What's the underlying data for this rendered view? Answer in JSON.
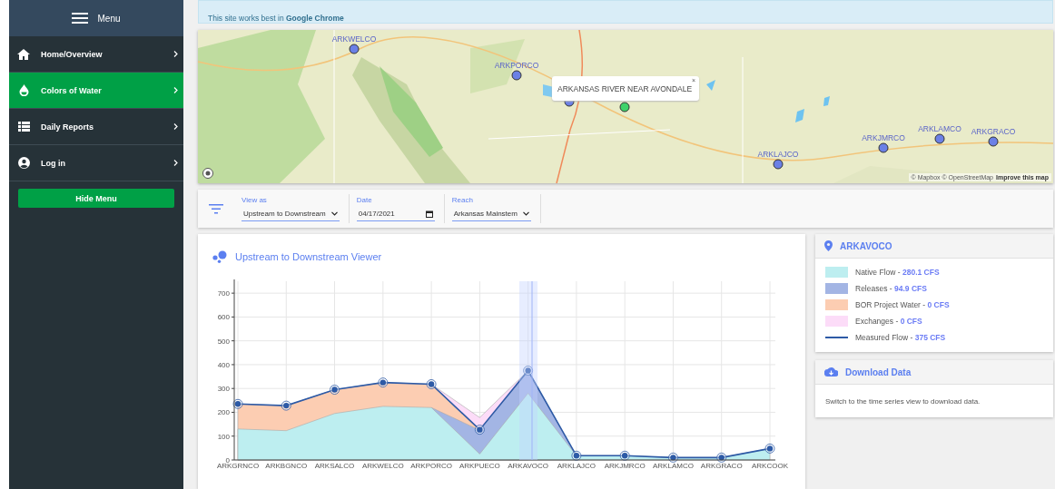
{
  "sidebar": {
    "title": "Menu",
    "items": [
      {
        "label": "Home/Overview",
        "selected": false
      },
      {
        "label": "Colors of Water",
        "selected": true
      },
      {
        "label": "Daily Reports",
        "selected": false
      },
      {
        "label": "Log in",
        "selected": false
      }
    ],
    "hide_button": "Hide Menu"
  },
  "notice": "This site works best in **Google Chrome**",
  "map": {
    "markers": [
      {
        "label": "ARKWELCO",
        "selected": false
      },
      {
        "label": "ARKPORCO",
        "selected": false
      },
      {
        "selected": false
      },
      {
        "selected": true
      },
      {
        "label": "ARKLAJCO",
        "selected": false
      },
      {
        "label": "ARKJMRCO",
        "selected": false
      },
      {
        "label": "ARKLAMCO",
        "selected": false
      },
      {
        "label": "ARKGRACO",
        "selected": false
      }
    ],
    "popup": "ARKANSAS RIVER NEAR AVONDALE",
    "popup_close": "×",
    "attribution": "© Mapbox © OpenStreetMap",
    "improve_link": "Improve this map"
  },
  "filters": [
    {
      "label": "View as",
      "value": "Upstream to Downstream",
      "kind": "select"
    },
    {
      "label": "Date",
      "value": "04/17/2021",
      "kind": "date"
    },
    {
      "label": "Reach",
      "value": "Arkansas Mainstem",
      "kind": "select"
    }
  ],
  "viewer": {
    "title": "Upstream to Downstream Viewer",
    "chart_data": {
      "type": "area",
      "grid": true,
      "categories": [
        "ARKGRNCO",
        "ARKBGNCO",
        "ARKSALCO",
        "ARKWELCO",
        "ARKPORCO",
        "ARKPUECO",
        "ARKAVOCO",
        "ARKLAJCO",
        "ARKJMRCO",
        "ARKLAMCO",
        "ARKGRACO",
        "ARKCOOK"
      ],
      "series": [
        {
          "name": "Native Flow",
          "color": "#bdeef0",
          "values": [
            130,
            123,
            195,
            225,
            220,
            25,
            280,
            18,
            18,
            10,
            10,
            48
          ]
        },
        {
          "name": "Releases",
          "color": "#a3b5e4",
          "values": [
            null,
            null,
            null,
            null,
            220,
            125,
            375,
            18,
            null,
            null,
            null,
            null
          ]
        },
        {
          "name": "BOR Project Water",
          "color": "#fccdb2",
          "values": [
            235,
            228,
            295,
            325,
            318,
            125,
            null,
            null,
            null,
            null,
            null,
            null
          ]
        },
        {
          "name": "Exchanges",
          "color": "#fcdcf8",
          "values": [
            null,
            null,
            null,
            null,
            318,
            178,
            375,
            null,
            null,
            null,
            null,
            null
          ]
        },
        {
          "name": "Measured Flow",
          "type": "line",
          "marker": "circle",
          "color": "#2d5aa6",
          "values": [
            235,
            228,
            295,
            325,
            318,
            127,
            375,
            18,
            18,
            10,
            10,
            48
          ]
        }
      ],
      "ylim": [
        0,
        750
      ],
      "yticks": [
        0,
        100,
        200,
        300,
        400,
        500,
        600,
        700
      ]
    }
  },
  "station": {
    "title": "ARKAVOCO",
    "legend": [
      {
        "kind": "swatch",
        "separator": "-",
        "value": "280.1 CFS"
      },
      {
        "kind": "swatch",
        "separator": "-",
        "value": "94.9 CFS"
      },
      {
        "kind": "swatch",
        "separator": "-",
        "value": "0 CFS"
      },
      {
        "kind": "swatch",
        "separator": "-",
        "value": "0 CFS"
      },
      {
        "kind": "line",
        "separator": "-",
        "value": "375 CFS"
      }
    ]
  },
  "download": {
    "title": "Download Data",
    "text": "Switch to the time series view to download data."
  }
}
